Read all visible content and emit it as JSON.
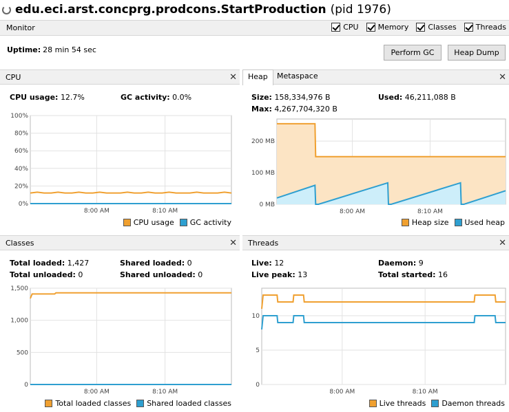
{
  "header": {
    "app_name": "edu.eci.arst.concprg.prodcons.StartProduction",
    "pid_text": "(pid 1976)"
  },
  "monitor": {
    "label": "Monitor",
    "checkboxes": [
      {
        "label": "CPU",
        "checked": true
      },
      {
        "label": "Memory",
        "checked": true
      },
      {
        "label": "Classes",
        "checked": true
      },
      {
        "label": "Threads",
        "checked": true
      }
    ]
  },
  "uptime": {
    "label": "Uptime:",
    "value": "28 min 54 sec"
  },
  "buttons": {
    "perform_gc": "Perform GC",
    "heap_dump": "Heap Dump"
  },
  "colors": {
    "orange": "#f0a030",
    "blue": "#2e9fd0",
    "orange_fill": "#fce4c4",
    "blue_fill": "#cdeefa"
  },
  "cpu": {
    "title": "CPU",
    "usage_label": "CPU usage:",
    "usage_value": "12.7%",
    "gc_label": "GC activity:",
    "gc_value": "0.0%",
    "legend": [
      "CPU usage",
      "GC activity"
    ],
    "chart_data": {
      "type": "line",
      "y_ticks": [
        "100%",
        "80%",
        "60%",
        "40%",
        "20%",
        "0%"
      ],
      "ylim": [
        0,
        100
      ],
      "x_ticks": [
        "8:00 AM",
        "8:10 AM"
      ],
      "series": [
        {
          "name": "CPU usage",
          "values": [
            12,
            13,
            12,
            12,
            13,
            12,
            12,
            13,
            12,
            12,
            13,
            12,
            12,
            12,
            13,
            12,
            12,
            13,
            12,
            12,
            13,
            12,
            12,
            12,
            13,
            12,
            12,
            12,
            13,
            12
          ]
        },
        {
          "name": "GC activity",
          "values": [
            0,
            0,
            0,
            0,
            0,
            0,
            0,
            0,
            0,
            0,
            0,
            0,
            0,
            0,
            0,
            0,
            0,
            0,
            0,
            0,
            0,
            0,
            0,
            0,
            0,
            0,
            0,
            0,
            0,
            0
          ]
        }
      ]
    }
  },
  "heap": {
    "tabs": [
      "Heap",
      "Metaspace"
    ],
    "size_label": "Size:",
    "size_value": "158,334,976 B",
    "used_label": "Used:",
    "used_value": "46,211,088 B",
    "max_label": "Max:",
    "max_value": "4,267,704,320 B",
    "legend": [
      "Heap size",
      "Used heap"
    ],
    "chart_data": {
      "type": "area",
      "y_ticks": [
        "200 MB",
        "100 MB",
        "0 MB"
      ],
      "ylim": [
        0,
        270
      ],
      "x_ticks": [
        "8:00 AM",
        "8:10 AM"
      ],
      "series": [
        {
          "name": "Heap size",
          "points": [
            [
              0,
              255
            ],
            [
              55,
              255
            ],
            [
              56,
              151
            ],
            [
              330,
              151
            ]
          ]
        },
        {
          "name": "Used heap",
          "points": [
            [
              0,
              20
            ],
            [
              55,
              60
            ],
            [
              56,
              0
            ],
            [
              60,
              0
            ],
            [
              160,
              68
            ],
            [
              161,
              0
            ],
            [
              165,
              0
            ],
            [
              265,
              68
            ],
            [
              266,
              0
            ],
            [
              270,
              0
            ],
            [
              330,
              43
            ]
          ]
        }
      ]
    }
  },
  "classes": {
    "title": "Classes",
    "total_loaded_label": "Total loaded:",
    "total_loaded_value": "1,427",
    "shared_loaded_label": "Shared loaded:",
    "shared_loaded_value": "0",
    "total_unloaded_label": "Total unloaded:",
    "total_unloaded_value": "0",
    "shared_unloaded_label": "Shared unloaded:",
    "shared_unloaded_value": "0",
    "legend": [
      "Total loaded classes",
      "Shared loaded classes"
    ],
    "chart_data": {
      "type": "line",
      "y_ticks": [
        "1,500",
        "1,000",
        "500",
        "0"
      ],
      "ylim": [
        0,
        1500
      ],
      "x_ticks": [
        "8:00 AM",
        "8:10 AM"
      ],
      "series": [
        {
          "name": "Total loaded classes",
          "points": [
            [
              0,
              1340
            ],
            [
              3,
              1410
            ],
            [
              40,
              1410
            ],
            [
              42,
              1427
            ],
            [
              330,
              1427
            ]
          ]
        },
        {
          "name": "Shared loaded classes",
          "points": [
            [
              0,
              0
            ],
            [
              330,
              0
            ]
          ]
        }
      ]
    }
  },
  "threads": {
    "title": "Threads",
    "live_label": "Live:",
    "live_value": "12",
    "daemon_label": "Daemon:",
    "daemon_value": "9",
    "live_peak_label": "Live peak:",
    "live_peak_value": "13",
    "total_started_label": "Total started:",
    "total_started_value": "16",
    "legend": [
      "Live threads",
      "Daemon threads"
    ],
    "chart_data": {
      "type": "line",
      "y_ticks": [
        "10",
        "5",
        "0"
      ],
      "ylim": [
        0,
        14
      ],
      "x_ticks": [
        "8:00 AM",
        "8:10 AM"
      ],
      "series": [
        {
          "name": "Live threads",
          "points": [
            [
              0,
              11
            ],
            [
              2,
              13
            ],
            [
              22,
              13
            ],
            [
              23,
              12
            ],
            [
              45,
              12
            ],
            [
              46,
              13
            ],
            [
              60,
              13
            ],
            [
              61,
              12
            ],
            [
              305,
              12
            ],
            [
              306,
              13
            ],
            [
              335,
              13
            ],
            [
              336,
              12
            ],
            [
              350,
              12
            ]
          ]
        },
        {
          "name": "Daemon threads",
          "points": [
            [
              0,
              8
            ],
            [
              2,
              10
            ],
            [
              22,
              10
            ],
            [
              23,
              9
            ],
            [
              45,
              9
            ],
            [
              46,
              10
            ],
            [
              60,
              10
            ],
            [
              61,
              9
            ],
            [
              305,
              9
            ],
            [
              306,
              10
            ],
            [
              335,
              10
            ],
            [
              336,
              9
            ],
            [
              350,
              9
            ]
          ]
        }
      ]
    }
  }
}
